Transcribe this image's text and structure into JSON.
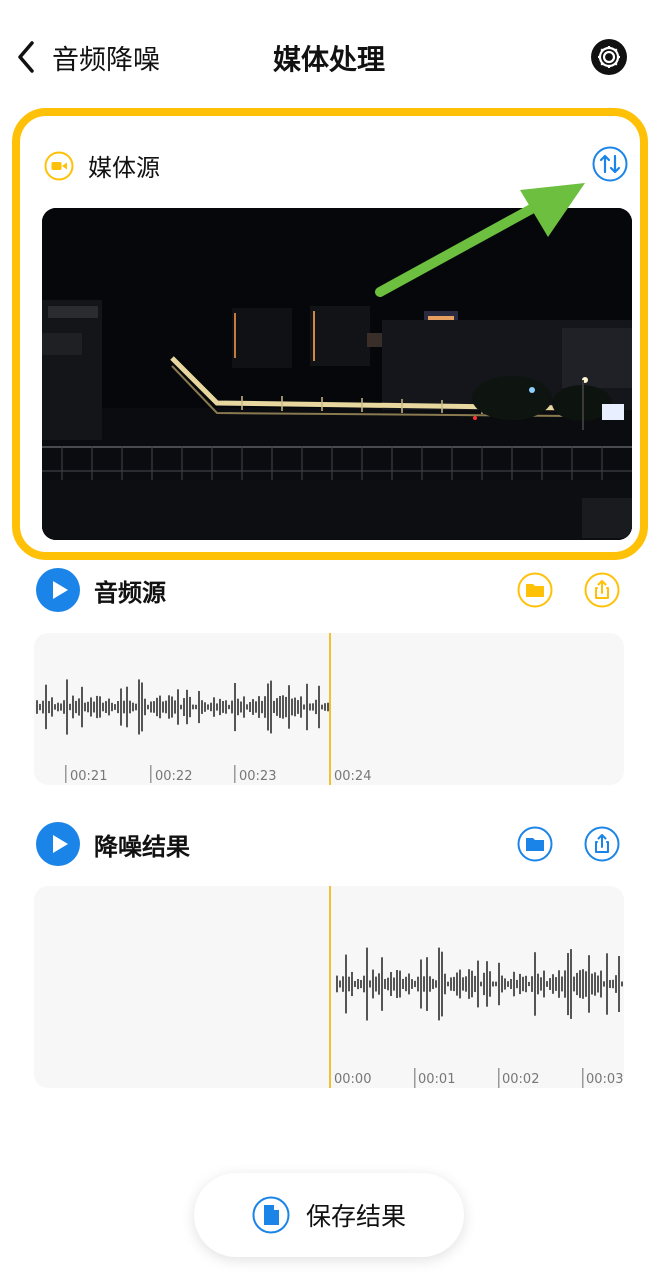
{
  "nav": {
    "back_label": "音频降噪",
    "title": "媒体处理"
  },
  "media_source": {
    "label": "媒体源"
  },
  "audio_source": {
    "label": "音频源",
    "timeline": [
      "00:21",
      "00:22",
      "00:23",
      "00:24"
    ]
  },
  "denoise_result": {
    "label": "降噪结果",
    "timeline": [
      "00:00",
      "00:01",
      "00:02",
      "00:03"
    ]
  },
  "save": {
    "label": "保存结果"
  },
  "icons": {
    "back": "chevron-left-icon",
    "settings": "gear-icon",
    "media": "video-camera-icon",
    "swap": "swap-vertical-icon",
    "play": "play-icon",
    "folder": "folder-icon",
    "share": "share-icon",
    "document": "document-icon"
  },
  "colors": {
    "accent_yellow": "#FFC107",
    "accent_blue": "#1A84E8",
    "arrow_green": "#6CBF3F",
    "playhead": "#F2C12E"
  }
}
